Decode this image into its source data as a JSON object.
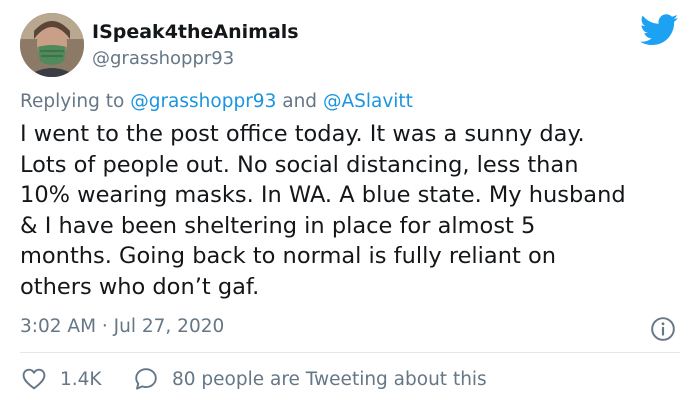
{
  "tweet": {
    "author": {
      "display_name": "ISpeak4theAnimals",
      "handle": "@grasshoppr93"
    },
    "reply": {
      "prefix": "Replying to",
      "mention_1": "@grasshoppr93",
      "joiner": "and",
      "mention_2": "@ASlavitt"
    },
    "text_lines": [
      "I went to the post office today. It was a sunny day.",
      "Lots of people out. No social distancing, less than",
      "10% wearing masks. In WA. A blue state. My husband",
      "& I have been sheltering in place for almost 5",
      "months. Going back to normal is fully reliant on",
      "others who don’t gaf."
    ],
    "timestamp": "3:02 AM · Jul 27, 2020",
    "likes": "1.4K",
    "conversation": "80 people are Tweeting about this"
  },
  "icons": {
    "brand": "twitter-bird-icon",
    "info": "info-icon",
    "like": "heart-icon",
    "reply": "speech-bubble-icon"
  },
  "colors": {
    "brand_blue": "#1da1f2",
    "mention_blue": "#1b95e0",
    "secondary_text": "#657786",
    "primary_text": "#14171a",
    "divider": "#e1e8ed"
  }
}
